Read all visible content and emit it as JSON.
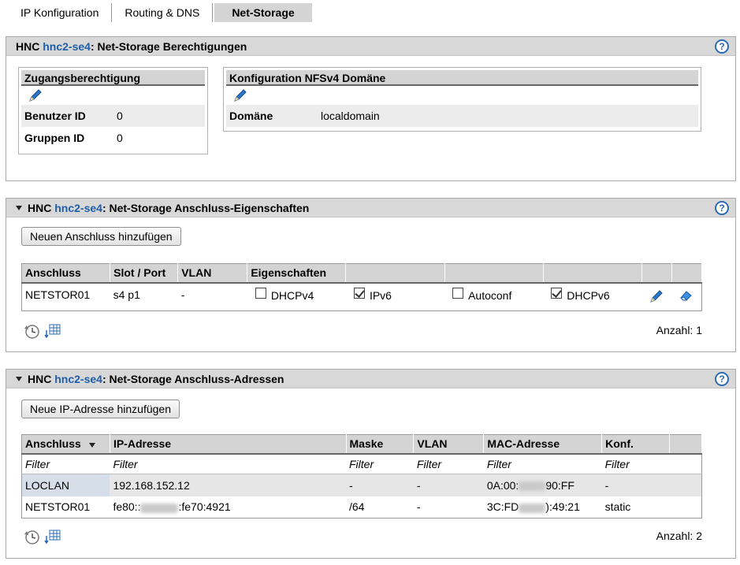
{
  "tabs": [
    {
      "label": "IP Konfiguration"
    },
    {
      "label": "Routing & DNS"
    },
    {
      "label": "Net-Storage"
    }
  ],
  "panel1": {
    "prefix": "HNC",
    "host": "hnc2-se4",
    "title": ": Net-Storage Berechtigungen",
    "zugang": {
      "title": "Zugangsberechtigung",
      "rows": [
        {
          "key": "Benutzer ID",
          "value": "0"
        },
        {
          "key": "Gruppen ID",
          "value": "0"
        }
      ]
    },
    "nfs": {
      "title": "Konfiguration NFSv4 Domäne",
      "rows": [
        {
          "key": "Domäne",
          "value": "localdomain"
        }
      ]
    }
  },
  "panel2": {
    "prefix": "HNC",
    "host": "hnc2-se4",
    "title": ": Net-Storage Anschluss-Eigenschaften",
    "add_button": "Neuen Anschluss hinzufügen",
    "columns": [
      "Anschluss",
      "Slot / Port",
      "VLAN",
      "Eigenschaften"
    ],
    "rows": [
      {
        "anschluss": "NETSTOR01",
        "slot_port": "s4 p1",
        "vlan": "-",
        "props": [
          {
            "label": "DHCPv4",
            "checked": false
          },
          {
            "label": "IPv6",
            "checked": true
          },
          {
            "label": "Autoconf",
            "checked": false
          },
          {
            "label": "DHCPv6",
            "checked": true
          }
        ]
      }
    ],
    "count_label": "Anzahl: 1"
  },
  "panel3": {
    "prefix": "HNC",
    "host": "hnc2-se4",
    "title": ": Net-Storage Anschluss-Adressen",
    "add_button": "Neue IP-Adresse hinzufügen",
    "columns": [
      "Anschluss",
      "IP-Adresse",
      "Maske",
      "VLAN",
      "MAC-Adresse",
      "Konf."
    ],
    "filter_label": "Filter",
    "rows": [
      {
        "anschluss": "LOCLAN",
        "ip": "192.168.152.12",
        "maske": "-",
        "vlan": "-",
        "mac_a": "0A:00:",
        "mac_b": "90:FF",
        "konf": "-"
      },
      {
        "anschluss": "NETSTOR01",
        "ip_a": "fe80::",
        "ip_b": ":fe70:4921",
        "maske": "/64",
        "vlan": "-",
        "mac_a": "3C:FD",
        "mac_b": "):49:21",
        "konf": "static"
      }
    ],
    "count_label": "Anzahl: 2"
  },
  "help_glyph": "?",
  "colors": {
    "host_link": "#1f5ea8",
    "header_bg": "#d8d8d8",
    "help": "#2d6bb5"
  }
}
